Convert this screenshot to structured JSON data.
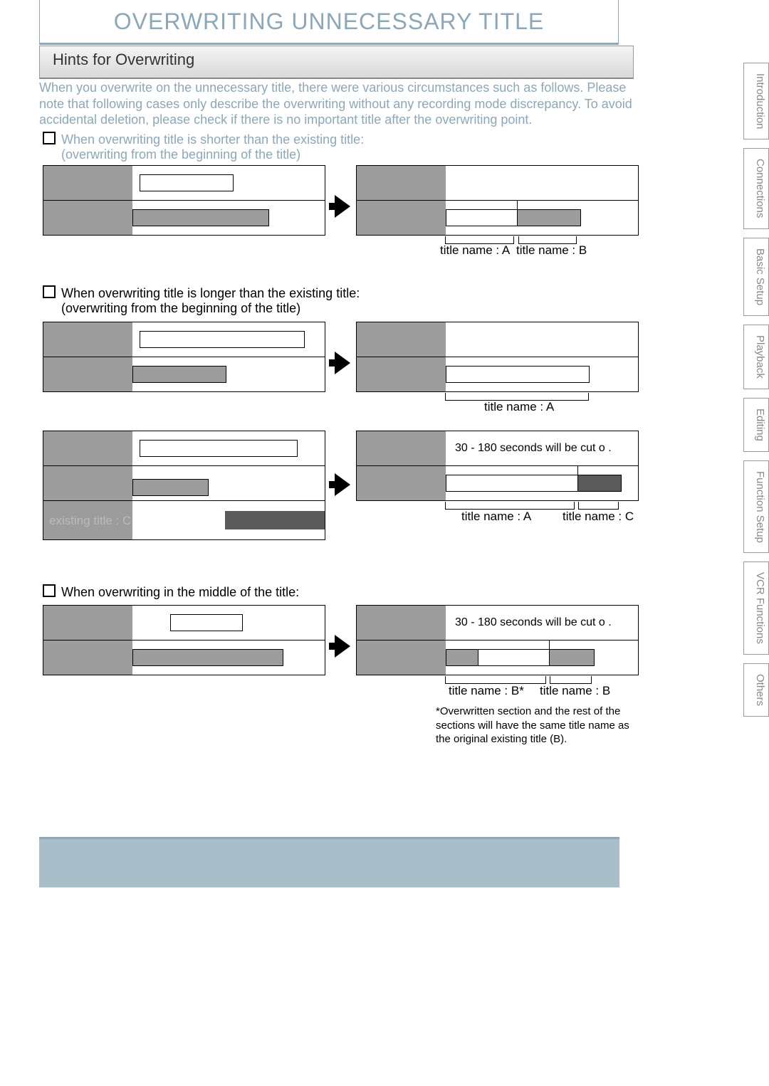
{
  "title": "OVERWRITING UNNECESSARY TITLE",
  "sub_header": "Hints for Overwriting",
  "intro": "When you overwrite on the unnecessary title, there were various circumstances such as follows.  Please note that following cases only describe the overwriting without any recording mode discrepancy.  To avoid accidental deletion, please check if there is no important title after the overwriting point.",
  "case1_line1": "When overwriting title is shorter than the existing title:",
  "case1_line2": "(overwriting from the beginning of the title)",
  "case2_line1": "When overwriting title is longer than the existing title:",
  "case2_line2": "(overwriting from the beginning of the title)",
  "case3_line1": "When overwriting in the middle of the title:",
  "existing_c": "existing title : C",
  "title_a": "title name : A",
  "title_b": "title name : B",
  "title_c": "title name : C",
  "title_b_star": "title name : B*",
  "cutoff_text": "30 - 180 seconds will be cut o .",
  "footnote": "*Overwritten section and the rest of the sections will have the same title name as the original existing title (B).",
  "tabs": [
    "Introduction",
    "Connections",
    "Basic Setup",
    "Playback",
    "Editing",
    "Function Setup",
    "VCR Functions",
    "Others"
  ]
}
